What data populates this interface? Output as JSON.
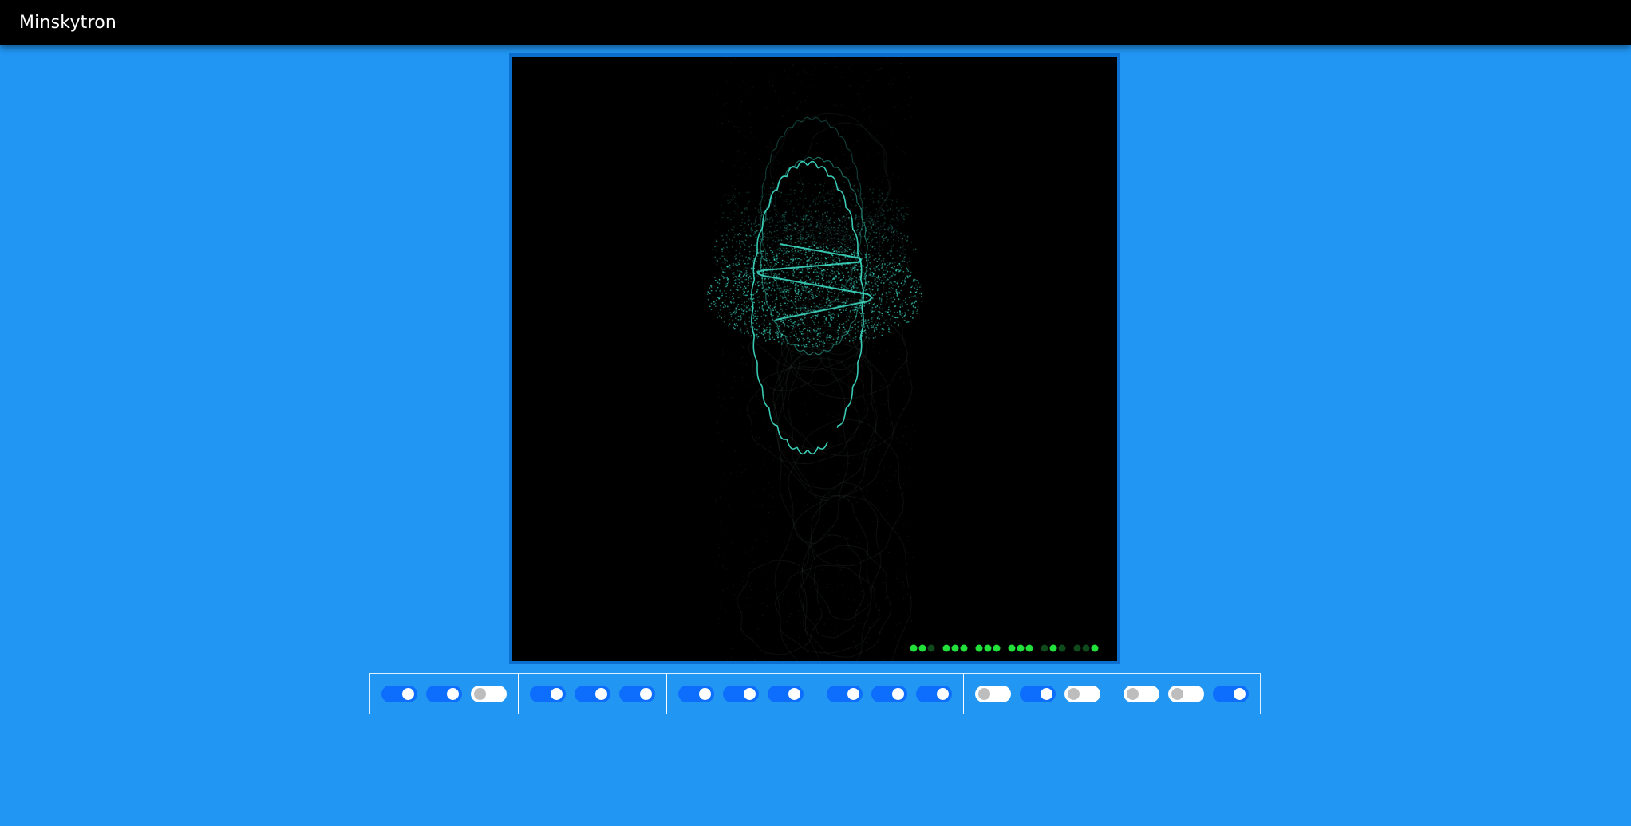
{
  "app": {
    "title": "Minskytron"
  },
  "colors": {
    "background": "#2196f3",
    "topbar": "#000000",
    "trace": "#3fe0c8",
    "led_on": "#22e13a",
    "led_off": "#0e4a1c",
    "toggle_on": "#0d6efd"
  },
  "display": {
    "led_groups": [
      [
        true,
        true,
        false
      ],
      [
        true,
        true,
        true
      ],
      [
        true,
        true,
        true
      ],
      [
        true,
        true,
        true
      ],
      [
        false,
        true,
        false
      ],
      [
        false,
        false,
        true
      ]
    ]
  },
  "control_groups": [
    {
      "toggles": [
        true,
        true,
        false
      ]
    },
    {
      "toggles": [
        true,
        true,
        true
      ]
    },
    {
      "toggles": [
        true,
        true,
        true
      ]
    },
    {
      "toggles": [
        true,
        true,
        true
      ]
    },
    {
      "toggles": [
        false,
        true,
        false
      ]
    },
    {
      "toggles": [
        false,
        false,
        true
      ]
    }
  ]
}
